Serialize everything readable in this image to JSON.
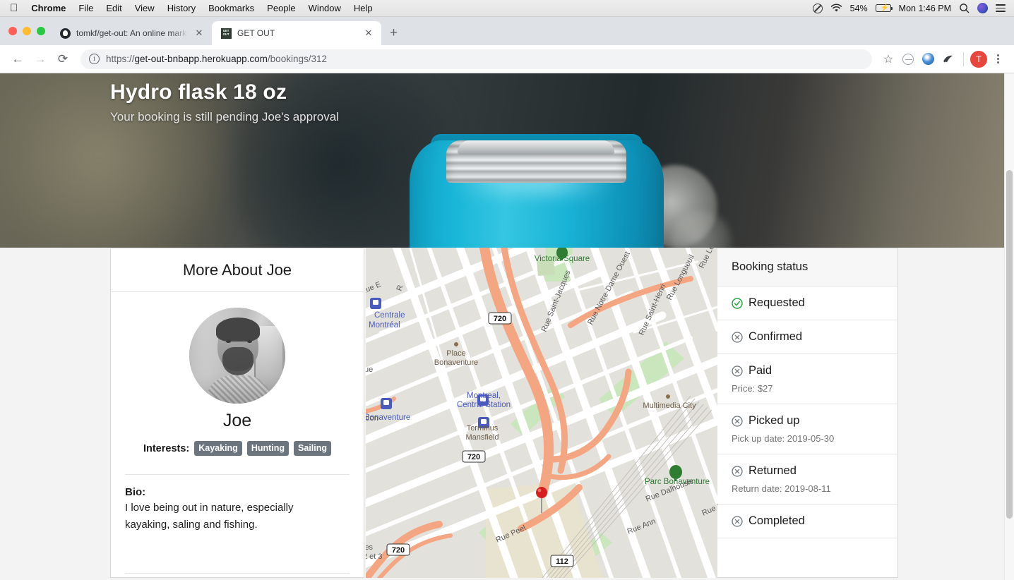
{
  "os_menubar": {
    "apple_icon": "apple-logo",
    "items": [
      "Chrome",
      "File",
      "Edit",
      "View",
      "History",
      "Bookmarks",
      "People",
      "Window",
      "Help"
    ],
    "status": {
      "dnd_icon": "do-not-disturb-icon",
      "wifi_icon": "wifi-icon",
      "battery_percent": "54%",
      "battery_icon": "battery-charging-icon",
      "clock": "Mon 1:46 PM",
      "search_icon": "spotlight-search-icon",
      "siri_icon": "siri-icon",
      "control_center_icon": "control-center-icon"
    }
  },
  "browser": {
    "tabs": [
      {
        "title": "tomkf/get-out: An online marke",
        "favicon": "github-icon",
        "active": false
      },
      {
        "title": "GET OUT",
        "favicon": "get-out-icon",
        "active": true
      }
    ],
    "new_tab_label": "+",
    "close_label": "✕",
    "toolbar": {
      "back": "←",
      "forward": "→",
      "reload": "⟳",
      "url_scheme": "https://",
      "url_host": "get-out-bnbapp.herokuapp.com",
      "url_path": "/bookings/312",
      "url_full": "https://get-out-bnbapp.herokuapp.com/bookings/312",
      "star_icon": "bookmark-star-icon",
      "ext1_icon": "extension-circle-icon",
      "ext2_icon": "extension-blue-orb-icon",
      "ext3_icon": "extension-icon",
      "profile_initial": "T",
      "menu_icon": "three-dot-menu-icon"
    }
  },
  "hero": {
    "title": "Hydro flask 18 oz",
    "subtitle": "Your booking is still pending Joe's approval",
    "image_alt": "teal hydro flask bottle close-up"
  },
  "profile": {
    "heading": "More About Joe",
    "avatar_alt": "Joe profile photo",
    "name": "Joe",
    "interests_label": "Interests:",
    "interests": [
      "Kayaking",
      "Hunting",
      "Sailing"
    ],
    "bio_label": "Bio:",
    "bio_text": "I love being out in nature, especially kayaking, saling and fishing."
  },
  "map": {
    "marker": "location-pin",
    "labels": [
      "Victoria Square",
      "Rue Saint-Jacques",
      "Rue Notre-Dame Ouest",
      "Rue Saint-Henri",
      "Rue Longueuil",
      "Rue Le M",
      "Multimedia City",
      "Parc Bonaventure",
      "Rue Dalhousie",
      "Rue Ann",
      "Rue Peel",
      "Place Bonaventure",
      "Montreal,",
      "Central Station",
      "Centrale",
      "Montréal",
      "Terminus",
      "Mansfield",
      "Bonaventure",
      "Rue E",
      "Rue P",
      "tion",
      "les",
      "2 et 3",
      "ue",
      "l",
      "les"
    ],
    "shields": [
      "720",
      "720",
      "720",
      "112"
    ]
  },
  "booking_status": {
    "heading": "Booking status",
    "items": [
      {
        "label": "Requested",
        "state": "done",
        "icon": "check-circle-icon",
        "detail": ""
      },
      {
        "label": "Confirmed",
        "state": "pending",
        "icon": "x-circle-icon",
        "detail": ""
      },
      {
        "label": "Paid",
        "state": "pending",
        "icon": "x-circle-icon",
        "detail": "Price: $27"
      },
      {
        "label": "Picked up",
        "state": "pending",
        "icon": "x-circle-icon",
        "detail": "Pick up date: 2019-05-30"
      },
      {
        "label": "Returned",
        "state": "pending",
        "icon": "x-circle-icon",
        "detail": "Return date: 2019-08-11"
      },
      {
        "label": "Completed",
        "state": "pending",
        "icon": "x-circle-icon",
        "detail": ""
      }
    ]
  },
  "colors": {
    "status_done": "#28a745",
    "status_pending": "#6c757d",
    "badge_bg": "#6c757d",
    "page_bg": "#f3f3f3",
    "avatar_red": "#e8453c",
    "bottle_teal": "#19b6d8"
  }
}
